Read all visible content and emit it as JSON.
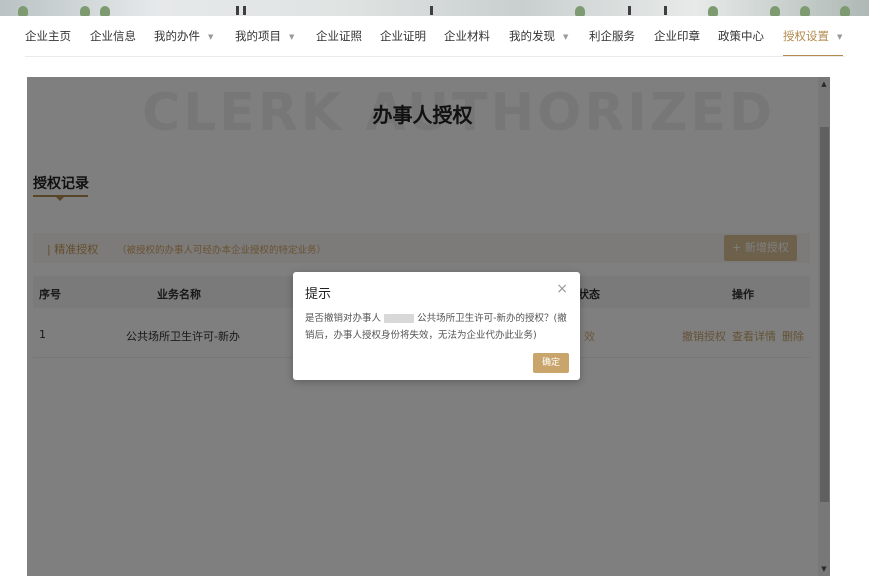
{
  "nav": {
    "items": [
      {
        "label": "企业主页"
      },
      {
        "label": "企业信息"
      },
      {
        "label": "我的办件"
      },
      {
        "label": "我的项目"
      },
      {
        "label": "企业证照"
      },
      {
        "label": "企业证明"
      },
      {
        "label": "企业材料"
      },
      {
        "label": "我的发现"
      },
      {
        "label": "利企服务"
      },
      {
        "label": "企业印章"
      },
      {
        "label": "政策中心"
      },
      {
        "label": "授权设置"
      }
    ],
    "active_label": "授权设置",
    "accent_color": "#b38b4f"
  },
  "page": {
    "watermark": "CLERK AUTHORIZED",
    "title": "办事人授权",
    "section_title": "授权记录",
    "filter_label": "| 精准授权",
    "filter_hint": "（被授权的办事人可经办本企业授权的特定业务）",
    "add_button": "+ 新增授权"
  },
  "table": {
    "headers": {
      "index": "序号",
      "business": "业务名称",
      "status": "状态",
      "actions": "操作"
    },
    "rows": [
      {
        "index": "1",
        "business": "公共场所卫生许可-新办",
        "status": "效",
        "actions": [
          "撤销授权",
          "查看详情",
          "删除"
        ]
      }
    ]
  },
  "dialog": {
    "title": "提示",
    "close_icon": "close-icon",
    "body_pre": "是否撤销对办事人",
    "body_post": "公共场所卫生许可-新办的授权？(撤销后，办事人授权身份将失效，无法为企业代办此业务)",
    "ok_label": "确定"
  }
}
